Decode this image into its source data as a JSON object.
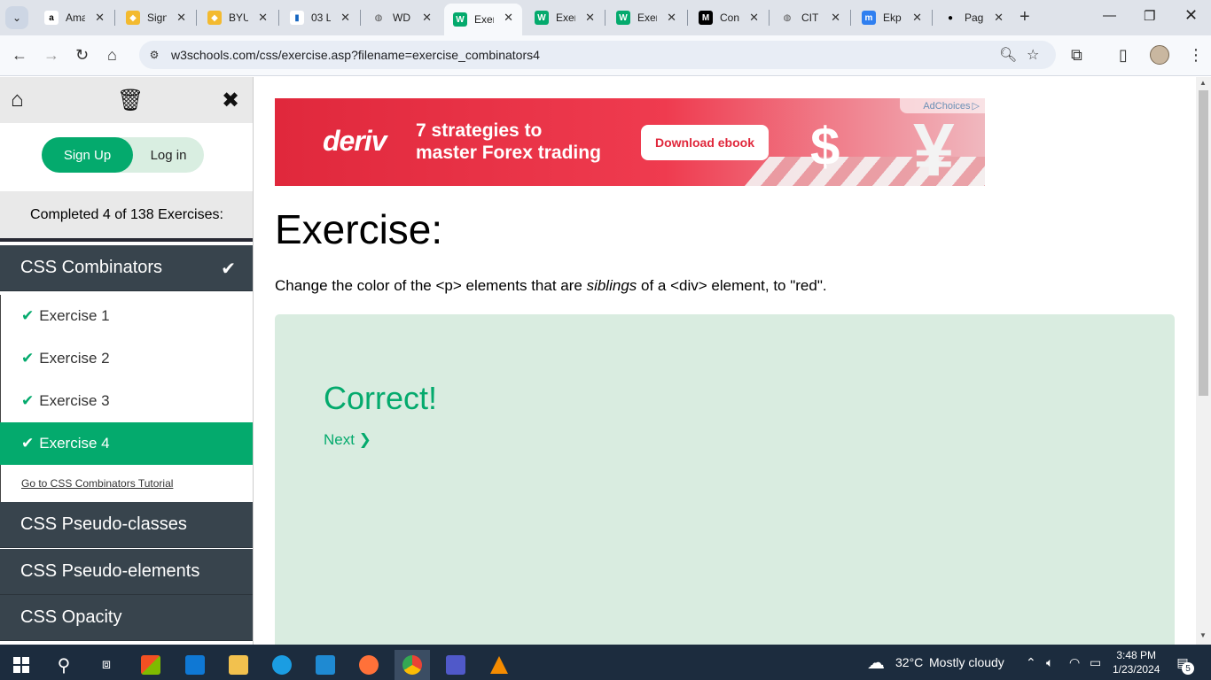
{
  "browser": {
    "tabs": [
      {
        "title": "Ama",
        "icon": "amazon-icon",
        "fav": "a",
        "fav_bg": "#ffffff",
        "fav_fg": "#000000"
      },
      {
        "title": "Sign",
        "icon": "binance-icon",
        "fav": "◆",
        "fav_bg": "#f3ba2f",
        "fav_fg": "#ffffff"
      },
      {
        "title": "BYU",
        "icon": "binance-icon",
        "fav": "◆",
        "fav_bg": "#f3ba2f",
        "fav_fg": "#ffffff"
      },
      {
        "title": "03 L",
        "icon": "bar-chart-icon",
        "fav": "▮",
        "fav_bg": "#ffffff",
        "fav_fg": "#1565c0"
      },
      {
        "title": "WD",
        "icon": "globe-icon",
        "fav": "◍",
        "fav_bg": "#dfe3ea",
        "fav_fg": "#555555"
      },
      {
        "title": "Exer",
        "icon": "w3schools-icon",
        "fav": "W",
        "fav_bg": "#04aa6d",
        "fav_fg": "#ffffff"
      },
      {
        "title": "Exer",
        "icon": "w3schools-icon",
        "fav": "W",
        "fav_bg": "#04aa6d",
        "fav_fg": "#ffffff"
      },
      {
        "title": "Exer",
        "icon": "w3schools-icon",
        "fav": "W",
        "fav_bg": "#04aa6d",
        "fav_fg": "#ffffff"
      },
      {
        "title": "Con",
        "icon": "m-logo-icon",
        "fav": "M",
        "fav_bg": "#000000",
        "fav_fg": "#ffffff"
      },
      {
        "title": "CIT",
        "icon": "globe-icon",
        "fav": "◍",
        "fav_bg": "#dfe3ea",
        "fav_fg": "#555555"
      },
      {
        "title": "Ekp",
        "icon": "meet-icon",
        "fav": "m",
        "fav_bg": "#2f7ff0",
        "fav_fg": "#ffffff"
      },
      {
        "title": "Pag",
        "icon": "github-icon",
        "fav": "●",
        "fav_bg": "#dfe3ea",
        "fav_fg": "#000000"
      }
    ],
    "url": "w3schools.com/css/exercise.asp?filename=exercise_combinators4"
  },
  "sidebar": {
    "signup_label": "Sign Up",
    "login_label": "Log in",
    "progress_text": "Completed 4 of 138 Exercises:",
    "current_section": "CSS Combinators",
    "exercises": [
      "Exercise 1",
      "Exercise 2",
      "Exercise 3",
      "Exercise 4"
    ],
    "active_exercise_index": 3,
    "tutorial_link": "Go to CSS Combinators Tutorial",
    "other_sections": [
      "CSS Pseudo-classes",
      "CSS Pseudo-elements",
      "CSS Opacity"
    ]
  },
  "ad": {
    "brand": "deriv",
    "headline_line1": "7 strategies to",
    "headline_line2": "master Forex trading",
    "button": "Download ebook",
    "adchoices": "AdChoices"
  },
  "main": {
    "title": "Exercise:",
    "desc_before": "Change the color of the <p> elements that are ",
    "desc_emphasis": "siblings",
    "desc_after": " of a <div> element, to \"red\".",
    "result": "Correct!",
    "next_label": "Next ❯"
  },
  "taskbar": {
    "weather_temp": "32°C",
    "weather_desc": "Mostly cloudy",
    "time": "3:48 PM",
    "date": "1/23/2024",
    "notifications": "5"
  },
  "colors": {
    "accent": "#04aa6d",
    "sidebar_dark": "#38444d",
    "result_bg": "#d9ece0",
    "ad_red": "#e0283c"
  }
}
